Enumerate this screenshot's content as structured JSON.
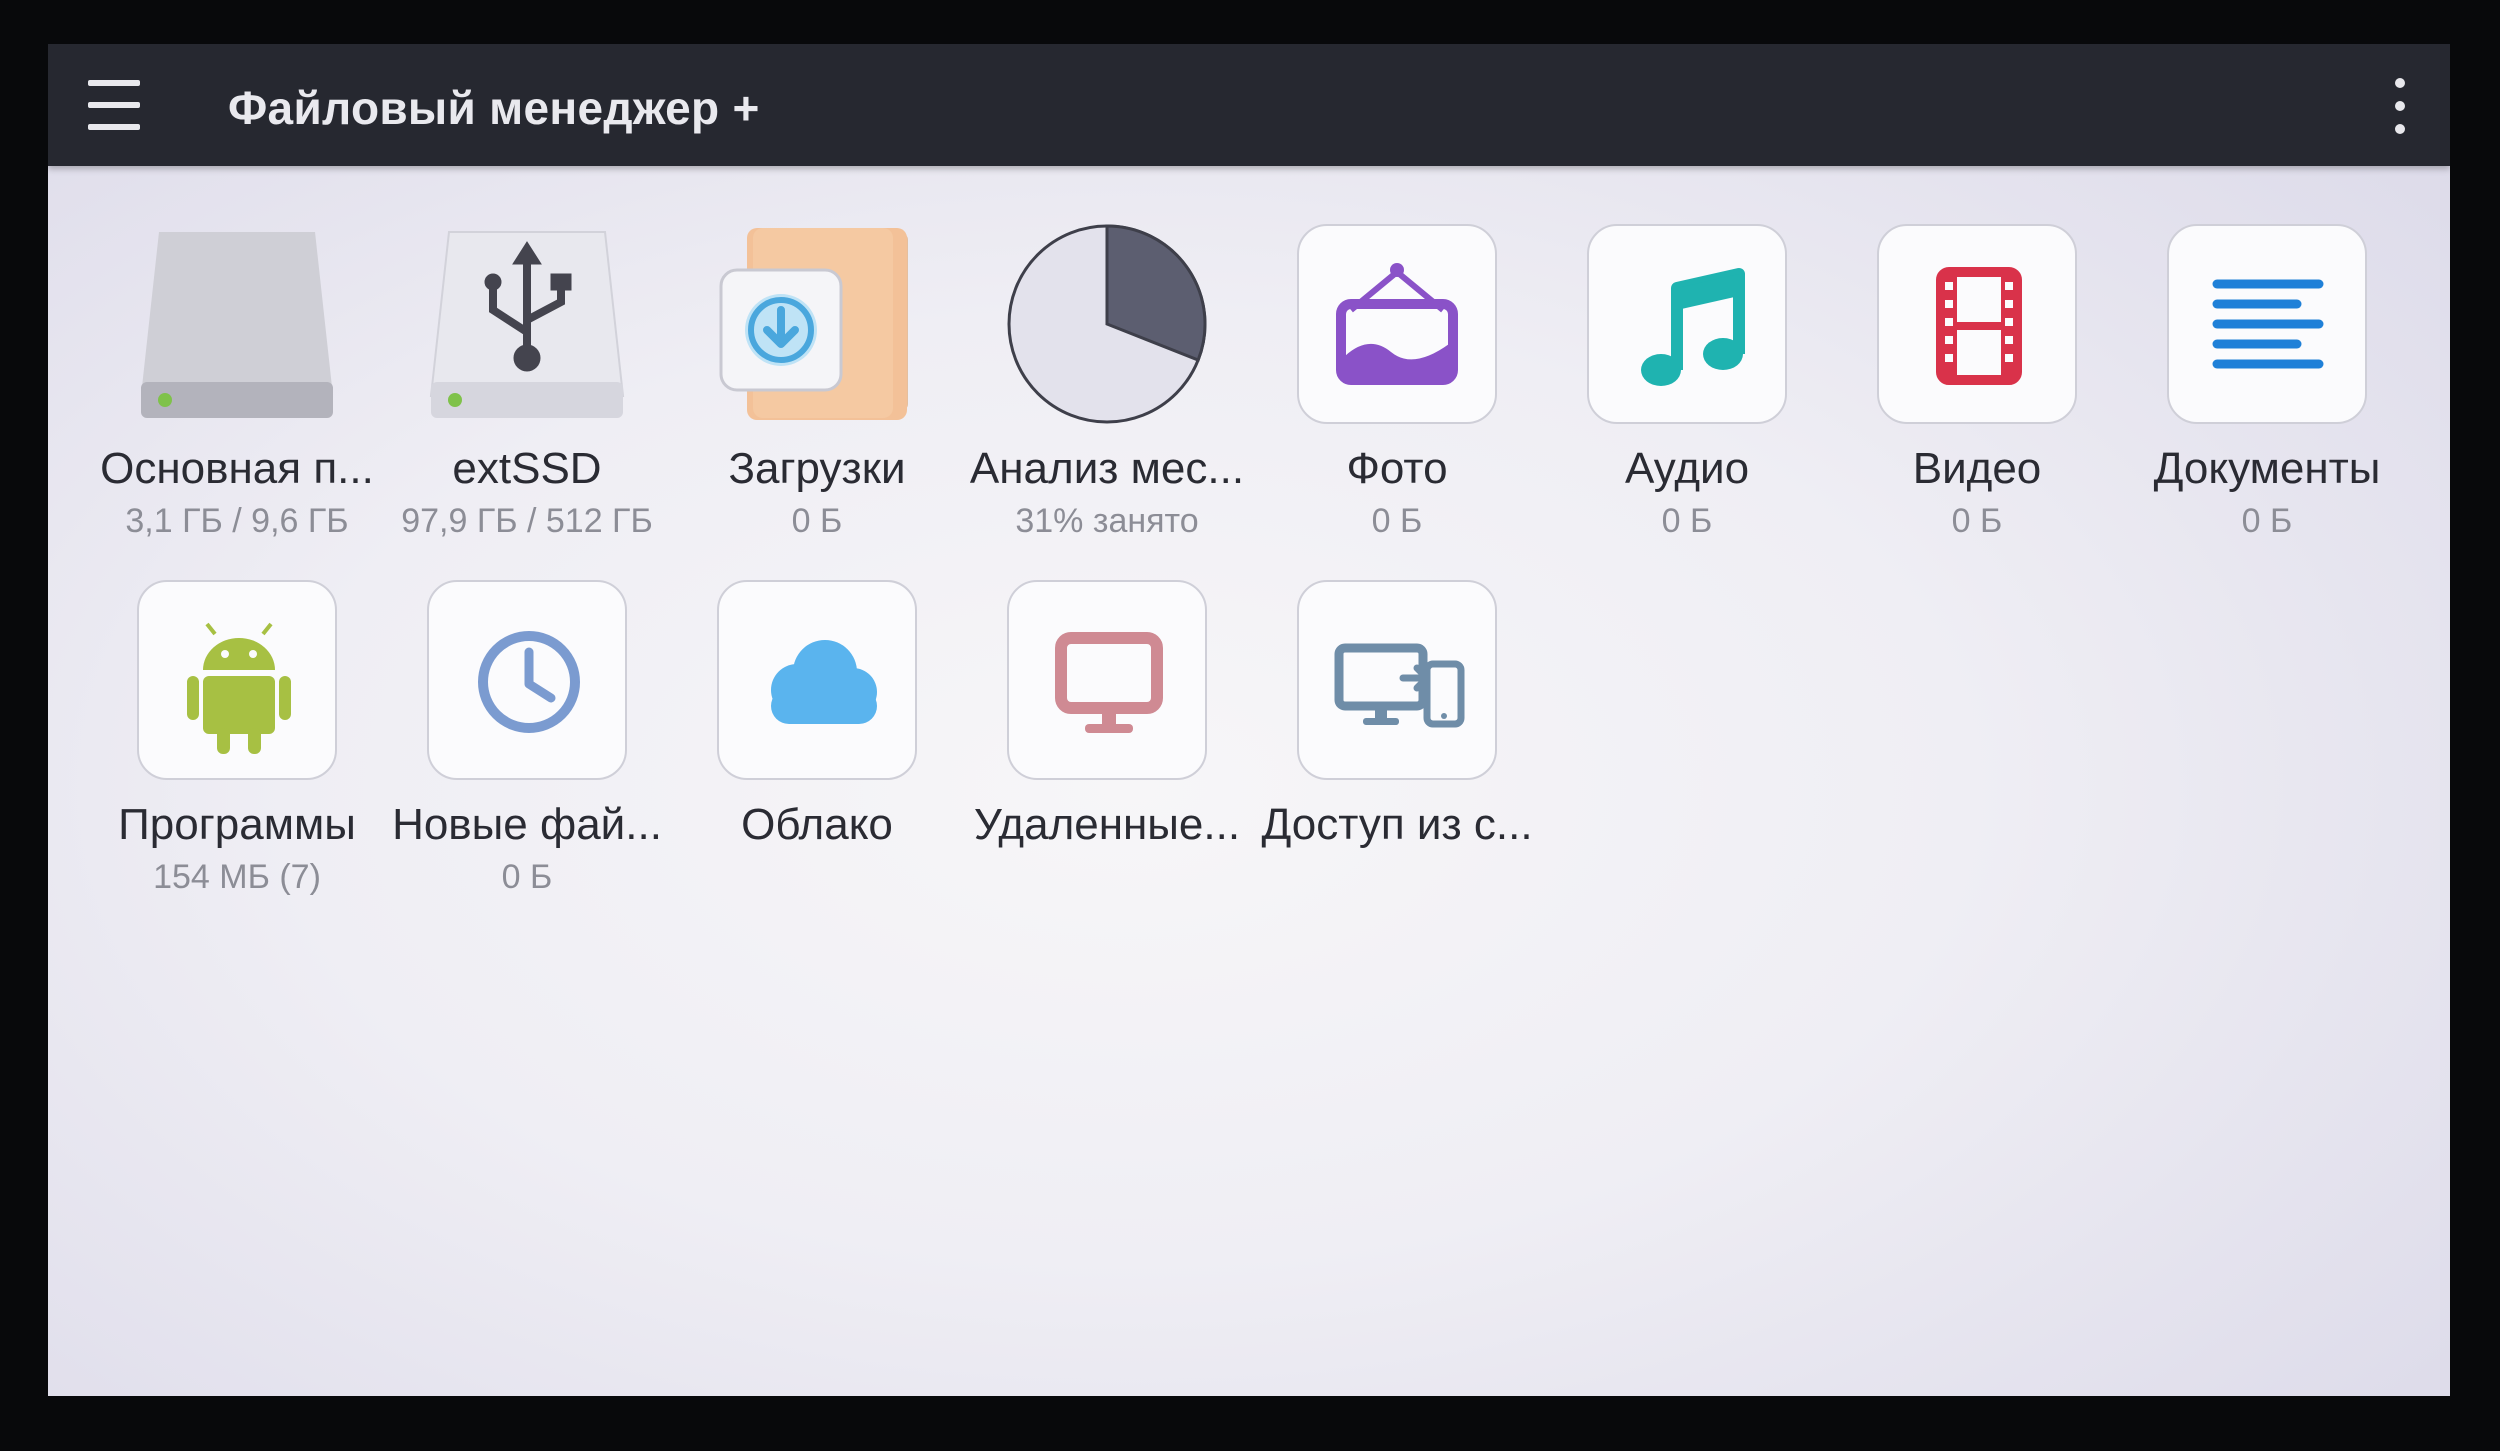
{
  "app": {
    "title": "Файловый менеджер +"
  },
  "toolbar": {
    "menu_icon": "hamburger-menu-icon",
    "overflow_icon": "more-vert-icon"
  },
  "tiles": [
    {
      "label": "Основная п...",
      "sub": "3,1 ГБ / 9,6 ГБ",
      "icon": "internal-storage-icon"
    },
    {
      "label": "extSSD",
      "sub": "97,9 ГБ / 512 ГБ",
      "icon": "usb-drive-icon"
    },
    {
      "label": "Загрузки",
      "sub": "0 Б",
      "icon": "downloads-folder-icon"
    },
    {
      "label": "Анализ мес...",
      "sub": "31% занято",
      "icon": "storage-analysis-pie-icon",
      "used_fraction": 0.31
    },
    {
      "label": "Фото",
      "sub": "0 Б",
      "icon": "photo-frame-icon",
      "color": "#8a52c8"
    },
    {
      "label": "Аудио",
      "sub": "0 Б",
      "icon": "music-note-icon",
      "color": "#1fb3b0"
    },
    {
      "label": "Видео",
      "sub": "0 Б",
      "icon": "film-strip-icon",
      "color": "#d9324a"
    },
    {
      "label": "Документы",
      "sub": "0 Б",
      "icon": "document-lines-icon",
      "color": "#1f80d8"
    },
    {
      "label": "Программы",
      "sub": "154 МБ (7)",
      "icon": "android-icon",
      "color": "#a7c043"
    },
    {
      "label": "Новые фай...",
      "sub": "0 Б",
      "icon": "clock-icon",
      "color": "#7b9bd0"
    },
    {
      "label": "Облако",
      "sub": "",
      "icon": "cloud-icon",
      "color": "#5ab4ee"
    },
    {
      "label": "Удаленные...",
      "sub": "",
      "icon": "monitor-icon",
      "color": "#cf8a93"
    },
    {
      "label": "Доступ из с...",
      "sub": "",
      "icon": "pc-to-phone-icon",
      "color": "#6f8da8"
    }
  ]
}
